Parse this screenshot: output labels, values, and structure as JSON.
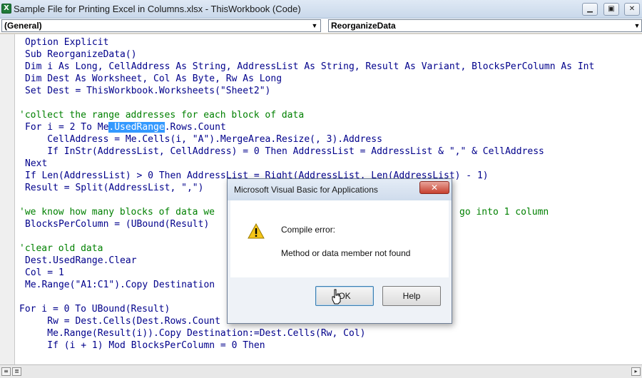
{
  "window": {
    "title": "Sample File for Printing Excel in Columns.xlsx - ThisWorkbook (Code)",
    "min_glyph": "▁",
    "restore_glyph": "▣",
    "close_glyph": "✕"
  },
  "combos": {
    "object": {
      "value": "(General)",
      "arrow": "▼"
    },
    "procedure": {
      "value": "ReorganizeData",
      "arrow": "▼"
    }
  },
  "code_lines": {
    "l1": "Option Explicit",
    "l2": "Sub ReorganizeData()",
    "l3": "Dim i As Long, CellAddress As String, AddressList As String, Result As Variant, BlocksPerColumn As Int",
    "l4": "Dim Dest As Worksheet, Col As Byte, Rw As Long",
    "l5": "Set Dest = ThisWorkbook.Worksheets(\"Sheet2\")",
    "l7": "'collect the range addresses for each block of data",
    "l8a": "For i = 2 To Me",
    "l8b": ".UsedRange",
    "l8c": ".Rows.Count",
    "l9": "    CellAddress = Me.Cells(i, \"A\").MergeArea.Resize(, 3).Address",
    "l10": "    If InStr(AddressList, CellAddress) = 0 Then AddressList = AddressList & \",\" & CellAddress",
    "l11": "Next",
    "l12": "If Len(AddressList) > 0 Then AddressList = Right(AddressList, Len(AddressList) - 1)",
    "l13": "Result = Split(AddressList, \",\")",
    "l15a": "'we know how many blocks of data we",
    "l15b": "go into 1 column",
    "l16": "BlocksPerColumn = (UBound(Result)",
    "l18": "'clear old data",
    "l19": "Dest.UsedRange.Clear",
    "l20": "Col = 1",
    "l21": "Me.Range(\"A1:C1\").Copy Destination",
    "l23": "For i = 0 To UBound(Result)",
    "l24": "    Rw = Dest.Cells(Dest.Rows.Count",
    "l25": "    Me.Range(Result(i)).Copy Destination:=Dest.Cells(Rw, Col)",
    "l26": "    If (i + 1) Mod BlocksPerColumn = 0 Then"
  },
  "dialog": {
    "title": "Microsoft Visual Basic for Applications",
    "close_glyph": "✕",
    "heading": "Compile error:",
    "message": "Method or data member not found",
    "ok_label": "OK",
    "help_label": "Help"
  },
  "colors": {
    "selection": "#3399ff",
    "comment": "#008000",
    "keyword": "#00008b",
    "close_button": "#c7402f"
  }
}
